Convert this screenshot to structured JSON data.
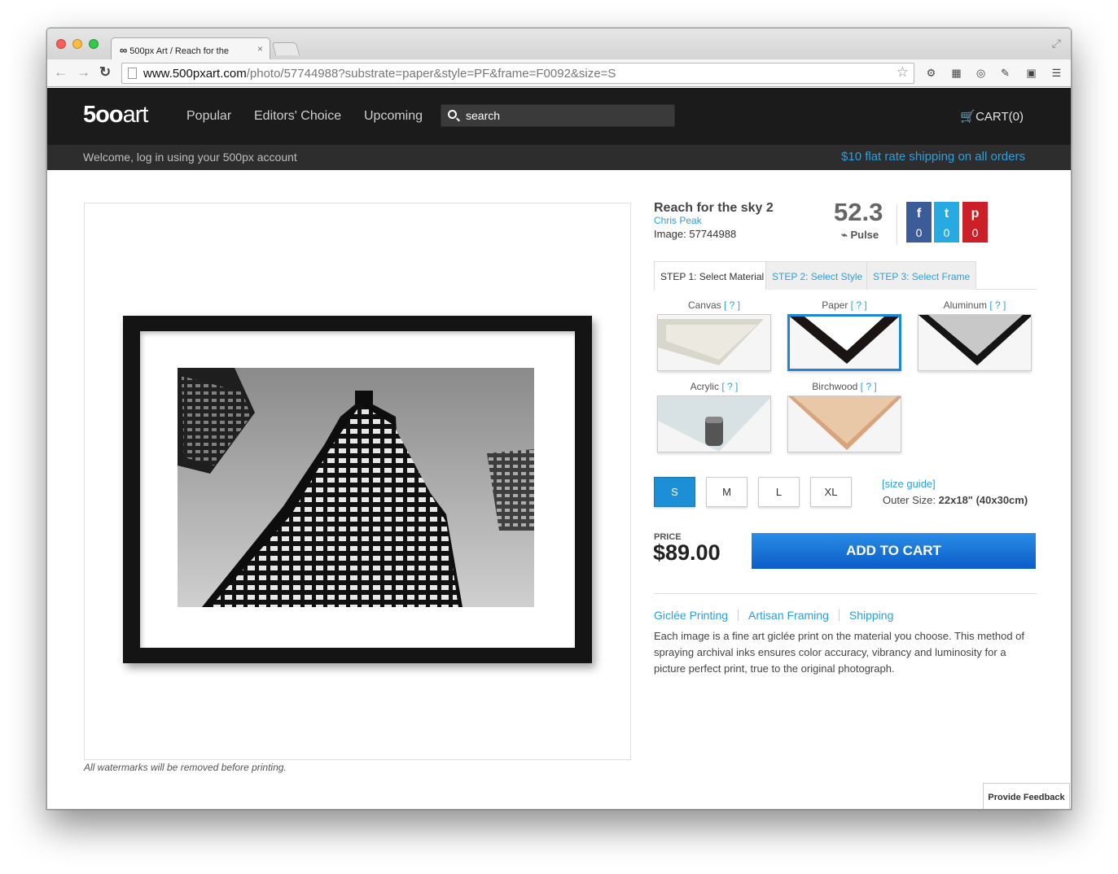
{
  "browser": {
    "tab_title": "500px Art / Reach for the",
    "tab_close": "×",
    "url_host": "www.500pxart.com",
    "url_path": "/photo/57744988?substrate=paper&style=PF&frame=F0092&size=S"
  },
  "header": {
    "logo_bold": "5oo",
    "logo_rest": "art",
    "nav": [
      "Popular",
      "Editors' Choice",
      "Upcoming"
    ],
    "search_placeholder": "search",
    "cart": "CART(0)"
  },
  "subbar": {
    "welcome": "Welcome, log in using your 500px account",
    "shipping": "$10 flat rate shipping on all orders"
  },
  "photo": {
    "watermark_note": "All watermarks will be removed before printing."
  },
  "product": {
    "title": "Reach for the sky 2",
    "author": "Chris Peak",
    "image_id": "Image: 57744988",
    "pulse_value": "52.3",
    "pulse_label": "Pulse",
    "social": [
      {
        "name": "facebook",
        "icon": "f",
        "count": "0",
        "color": "#3b5b99"
      },
      {
        "name": "twitter",
        "icon": "t",
        "count": "0",
        "color": "#27a9e1"
      },
      {
        "name": "pinterest",
        "icon": "p",
        "count": "0",
        "color": "#cb2028"
      }
    ]
  },
  "steps": [
    "STEP 1: Select Material",
    "STEP 2: Select Style",
    "STEP 3: Select Frame"
  ],
  "materials": [
    {
      "label": "Canvas",
      "help": "[ ? ]"
    },
    {
      "label": "Paper",
      "help": "[ ? ]"
    },
    {
      "label": "Aluminum",
      "help": "[ ? ]"
    },
    {
      "label": "Acrylic",
      "help": "[ ? ]"
    },
    {
      "label": "Birchwood",
      "help": "[ ? ]"
    }
  ],
  "selected_material": "Paper",
  "sizes": [
    "S",
    "M",
    "L",
    "XL"
  ],
  "selected_size": "S",
  "size_guide": "[size guide]",
  "outer_size_label": "Outer Size:",
  "outer_size_value": "22x18\" (40x30cm)",
  "price_label": "PRICE",
  "price": "$89.00",
  "add_to_cart": "ADD TO CART",
  "info_links": [
    "Giclée Printing",
    "Artisan Framing",
    "Shipping"
  ],
  "description": "Each image is a fine art giclée print on the material you choose. This method of spraying archival inks ensures color accuracy, vibrancy and luminosity for a picture perfect print, true to the original photograph.",
  "feedback": "Provide Feedback",
  "accent_color": "#2a9fe0"
}
